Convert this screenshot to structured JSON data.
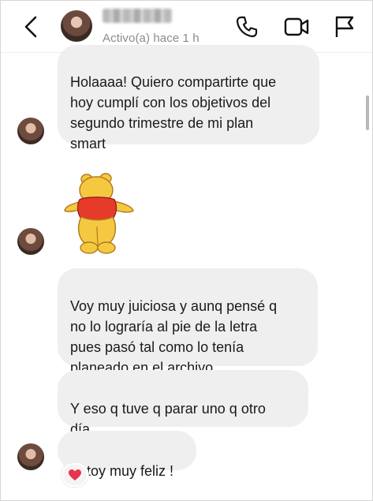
{
  "header": {
    "back_icon": "chevron-left-icon",
    "status": "Activo(a) hace 1 h",
    "icons": [
      "phone-icon",
      "video-call-icon",
      "flag-icon"
    ]
  },
  "messages": [
    {
      "type": "text",
      "text": "Holaaaa! Quiero compartirte que\nhoy cumplí con los objetivos del\nsegundo trimestre de mi plan\nsmart"
    },
    {
      "type": "sticker",
      "icon": "winnie-the-pooh-sticker"
    },
    {
      "type": "text",
      "text": "Voy muy juiciosa y aunq pensé q\nno lo lograría al pie de la letra\npues pasó tal como lo tenía\nplaneado en el archivo."
    },
    {
      "type": "text",
      "text": "Y eso q tuve q parar uno q otro\ndía."
    },
    {
      "type": "text",
      "text": "Estoy muy feliz !"
    }
  ],
  "reaction": {
    "emoji": "❤️",
    "icon": "heart-icon",
    "color": "#e8344c"
  },
  "colors": {
    "bubble": "#efefef",
    "status_text": "#8b8b8b",
    "icons": "#111111"
  }
}
